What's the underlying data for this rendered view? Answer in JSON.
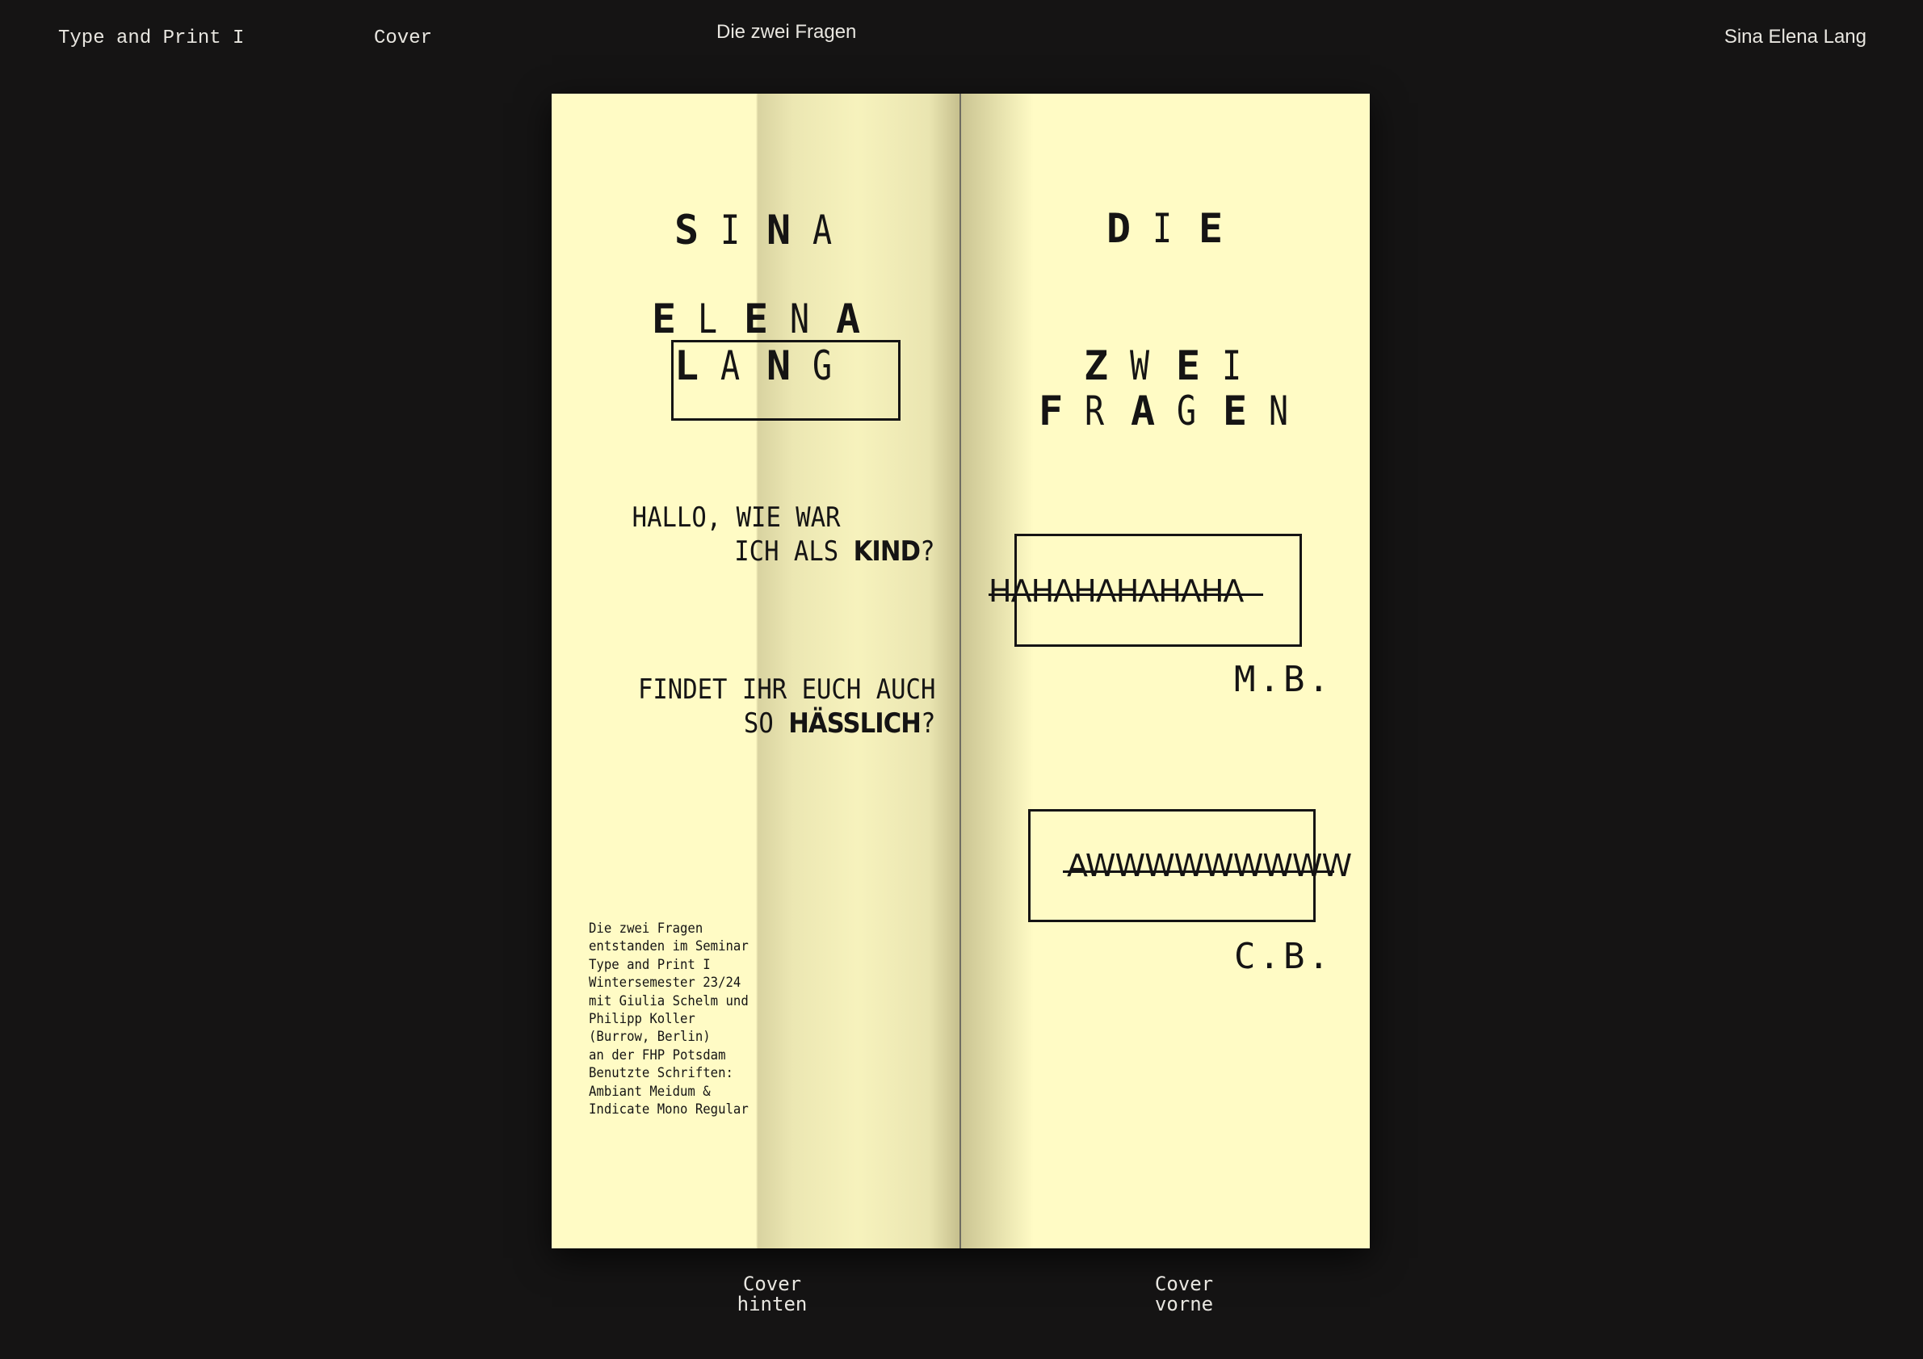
{
  "header": {
    "course": "Type and Print I",
    "section": "Cover",
    "project": "Die zwei Fragen",
    "author": "Sina Elena Lang"
  },
  "back_cover": {
    "name_first": [
      "S",
      "I",
      "N",
      "A"
    ],
    "name_middle": [
      "E",
      "L",
      "E",
      "N",
      "A"
    ],
    "name_last": [
      "L",
      "A",
      "N",
      "G"
    ],
    "q1_line1": "HALLO, WIE WAR",
    "q1_line2_pre": "ICH ALS ",
    "q1_line2_bold": "KIND",
    "q1_line2_post": "?",
    "q2_line1": "FINDET IHR EUCH AUCH",
    "q2_line2_pre": "SO ",
    "q2_line2_bold": "HÄSSLICH",
    "q2_line2_post": "?",
    "colophon": "Die zwei Fragen\nentstanden im Seminar\nType and Print I\nWintersemester 23/24\nmit Giulia Schelm und\nPhilipp Koller\n(Burrow, Berlin)\nan der FHP Potsdam\nBenutzte Schriften:\nAmbiant Meidum &\nIndicate Mono Regular"
  },
  "front_cover": {
    "title_1": [
      "D",
      "I",
      "E"
    ],
    "title_2": [
      "Z",
      "W",
      "E",
      "I"
    ],
    "title_3": [
      "F",
      "R",
      "A",
      "G",
      "E",
      "N"
    ],
    "answer_1": "HAHAHAHAHAHA",
    "initials_1": "M.B.",
    "answer_2": "AWWWWWWWWW",
    "initials_2": "C.B."
  },
  "captions": {
    "back": "Cover\nhinten",
    "front": "Cover\nvorne"
  }
}
